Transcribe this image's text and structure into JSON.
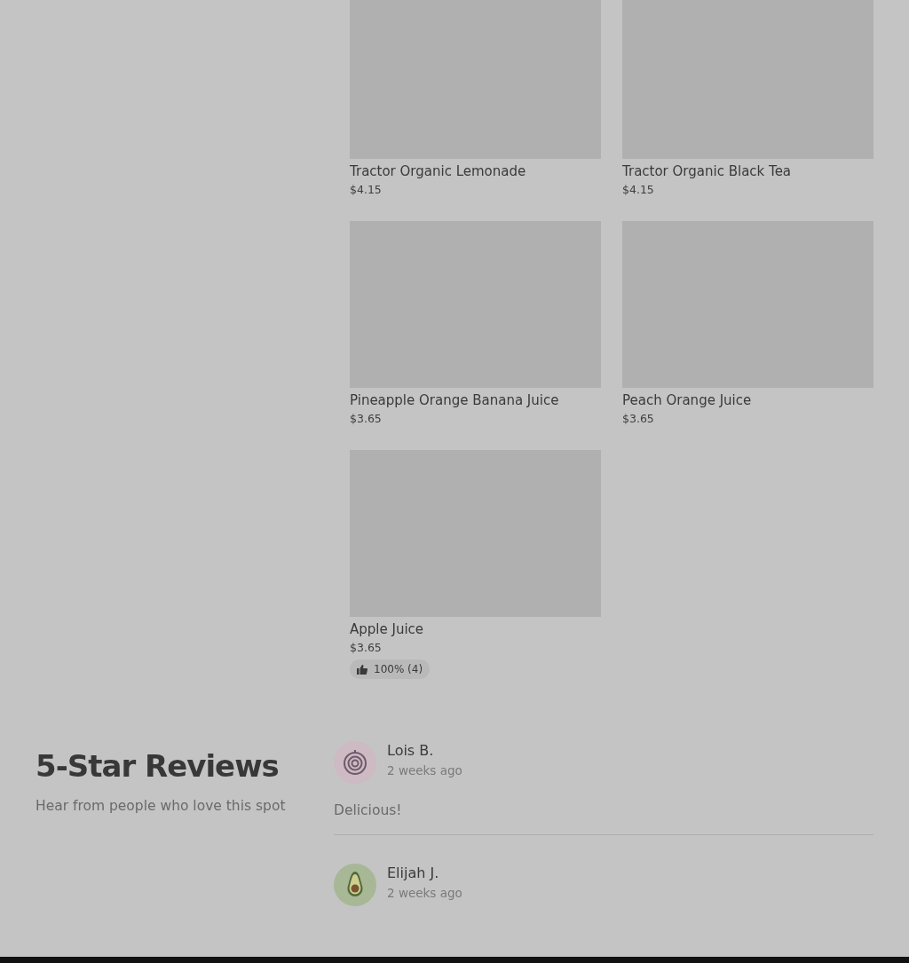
{
  "products": [
    {
      "name": "Tractor Organic Lemonade",
      "price": "$4.15"
    },
    {
      "name": "Tractor Organic Black Tea",
      "price": "$4.15"
    },
    {
      "name": "Pineapple Orange Banana Juice",
      "price": "$3.65"
    },
    {
      "name": "Peach Orange Juice",
      "price": "$3.65"
    },
    {
      "name": "Apple Juice",
      "price": "$3.65",
      "rating": "100% (4)"
    }
  ],
  "reviews_section": {
    "title": "5-Star Reviews",
    "subtitle": "Hear from people who love this spot",
    "reviews": [
      {
        "kind": "onion",
        "name": "Lois B.",
        "time": "2 weeks ago",
        "text": "Delicious!"
      },
      {
        "kind": "avocado",
        "name": "Elijah J.",
        "time": "2 weeks ago"
      }
    ]
  }
}
